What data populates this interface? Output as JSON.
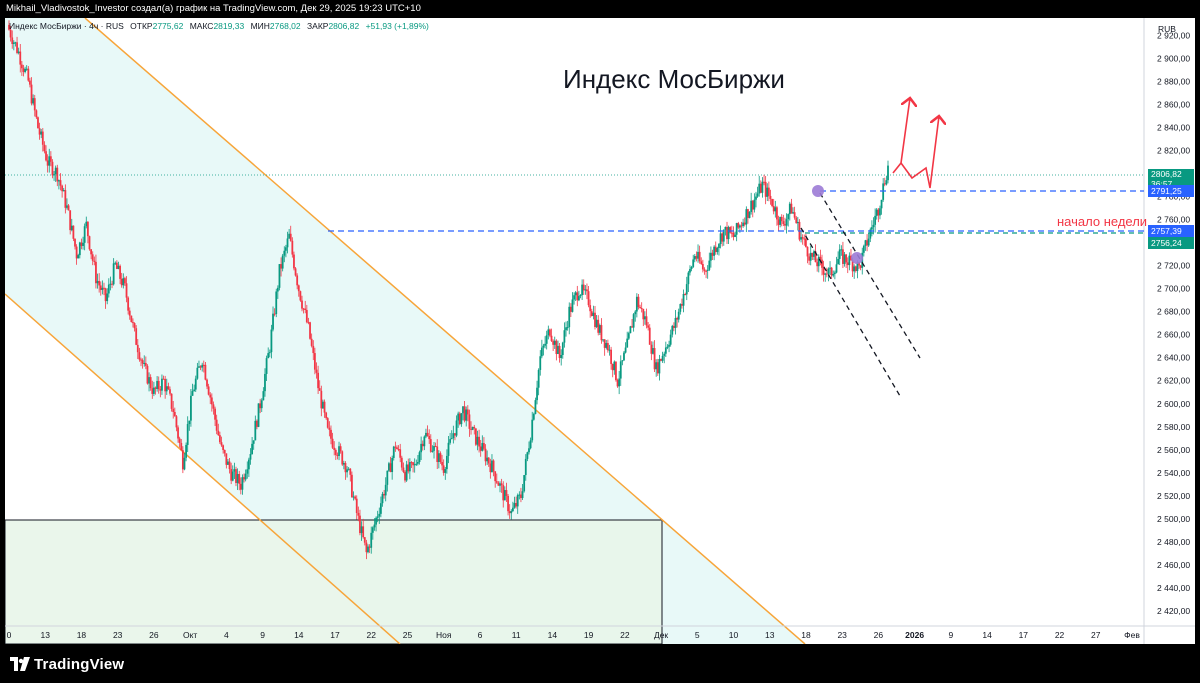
{
  "header": {
    "attribution": "Mikhail_Vladivostok_Investor создал(а) график на TradingView.com, Дек 29, 2025 19:23 UTC+10"
  },
  "legend": {
    "symbol": "Индекс МосБиржи · 4ч · RUS",
    "open_label": "ОТКР",
    "open": "2775,62",
    "high_label": "МАКС",
    "high": "2819,33",
    "low_label": "МИН",
    "low": "2768,02",
    "close_label": "ЗАКР",
    "close": "2806,82",
    "change": "+51,93 (+1,89%)"
  },
  "footer": {
    "brand": "TradingView"
  },
  "price_tags": {
    "last": "2806,82",
    "countdown": "36:57",
    "level_high": "2791,25",
    "level_week": "2757,39",
    "prev": "2756,24"
  },
  "colors": {
    "up": "#089981",
    "down": "#f23645",
    "channel_line": "#f7a53a",
    "channel_fill": "#e0f7f5",
    "box_fill": "#e8f5e9",
    "level_line": "#2962ff",
    "arrow": "#f23645",
    "marker": "#9c7bd6",
    "tag_green": "#089981",
    "tag_blue": "#2962ff"
  },
  "chart_data": {
    "type": "candlestick",
    "title": "Индекс МосБиржи",
    "currency": "RUB",
    "annotation": "начало недели",
    "ylim": [
      2407,
      2935
    ],
    "y_ticks": [
      2420,
      2440,
      2460,
      2480,
      2500,
      2520,
      2540,
      2560,
      2580,
      2600,
      2620,
      2640,
      2660,
      2680,
      2700,
      2720,
      2740,
      2760,
      2780,
      2800,
      2820,
      2840,
      2860,
      2880,
      2900,
      2920
    ],
    "y_tick_labels": [
      "2 420,00",
      "2 440,00",
      "2 460,00",
      "2 480,00",
      "2 500,00",
      "2 520,00",
      "2 540,00",
      "2 560,00",
      "2 580,00",
      "2 600,00",
      "2 620,00",
      "2 640,00",
      "2 660,00",
      "2 680,00",
      "2 700,00",
      "2 720,00",
      "2 740,00",
      "2 760,00",
      "2 780,00",
      "2 800,00",
      "2 820,00",
      "2 840,00",
      "2 860,00",
      "2 880,00",
      "2 900,00",
      "2 920,00"
    ],
    "x_ticks": [
      "0",
      "13",
      "18",
      "23",
      "26",
      "Окт",
      "4",
      "9",
      "14",
      "17",
      "22",
      "25",
      "Ноя",
      "6",
      "11",
      "14",
      "19",
      "22",
      "Дек",
      "5",
      "10",
      "13",
      "18",
      "23",
      "26",
      "2026",
      "9",
      "14",
      "17",
      "22",
      "27",
      "Фев"
    ],
    "levels": [
      2791.25,
      2757.39
    ],
    "path": [
      [
        0,
        2925
      ],
      [
        6,
        2905
      ],
      [
        12,
        2880
      ],
      [
        18,
        2840
      ],
      [
        24,
        2810
      ],
      [
        30,
        2800
      ],
      [
        36,
        2770
      ],
      [
        42,
        2730
      ],
      [
        48,
        2755
      ],
      [
        54,
        2710
      ],
      [
        60,
        2690
      ],
      [
        66,
        2720
      ],
      [
        72,
        2700
      ],
      [
        78,
        2660
      ],
      [
        84,
        2630
      ],
      [
        90,
        2610
      ],
      [
        96,
        2620
      ],
      [
        102,
        2595
      ],
      [
        108,
        2550
      ],
      [
        114,
        2610
      ],
      [
        120,
        2640
      ],
      [
        126,
        2600
      ],
      [
        132,
        2560
      ],
      [
        138,
        2540
      ],
      [
        144,
        2530
      ],
      [
        150,
        2560
      ],
      [
        156,
        2600
      ],
      [
        162,
        2650
      ],
      [
        168,
        2715
      ],
      [
        174,
        2745
      ],
      [
        180,
        2700
      ],
      [
        186,
        2665
      ],
      [
        192,
        2615
      ],
      [
        198,
        2575
      ],
      [
        204,
        2560
      ],
      [
        210,
        2545
      ],
      [
        216,
        2505
      ],
      [
        222,
        2470
      ],
      [
        228,
        2500
      ],
      [
        234,
        2530
      ],
      [
        240,
        2565
      ],
      [
        246,
        2540
      ],
      [
        252,
        2545
      ],
      [
        258,
        2575
      ],
      [
        264,
        2560
      ],
      [
        270,
        2545
      ],
      [
        276,
        2575
      ],
      [
        282,
        2595
      ],
      [
        288,
        2575
      ],
      [
        294,
        2560
      ],
      [
        300,
        2545
      ],
      [
        306,
        2525
      ],
      [
        312,
        2505
      ],
      [
        318,
        2520
      ],
      [
        324,
        2575
      ],
      [
        330,
        2640
      ],
      [
        336,
        2665
      ],
      [
        342,
        2640
      ],
      [
        348,
        2680
      ],
      [
        354,
        2700
      ],
      [
        360,
        2690
      ],
      [
        366,
        2665
      ],
      [
        372,
        2650
      ],
      [
        378,
        2620
      ],
      [
        384,
        2650
      ],
      [
        390,
        2690
      ],
      [
        396,
        2670
      ],
      [
        402,
        2630
      ],
      [
        408,
        2650
      ],
      [
        414,
        2670
      ],
      [
        420,
        2700
      ],
      [
        426,
        2730
      ],
      [
        432,
        2715
      ],
      [
        438,
        2735
      ],
      [
        444,
        2750
      ],
      [
        450,
        2745
      ],
      [
        456,
        2760
      ],
      [
        462,
        2775
      ],
      [
        468,
        2790
      ],
      [
        474,
        2775
      ],
      [
        480,
        2755
      ],
      [
        486,
        2770
      ],
      [
        492,
        2745
      ],
      [
        498,
        2728
      ],
      [
        504,
        2720
      ],
      [
        510,
        2712
      ],
      [
        516,
        2728
      ],
      [
        522,
        2724
      ],
      [
        528,
        2718
      ],
      [
        534,
        2745
      ],
      [
        540,
        2770
      ],
      [
        546,
        2806.82
      ]
    ]
  }
}
